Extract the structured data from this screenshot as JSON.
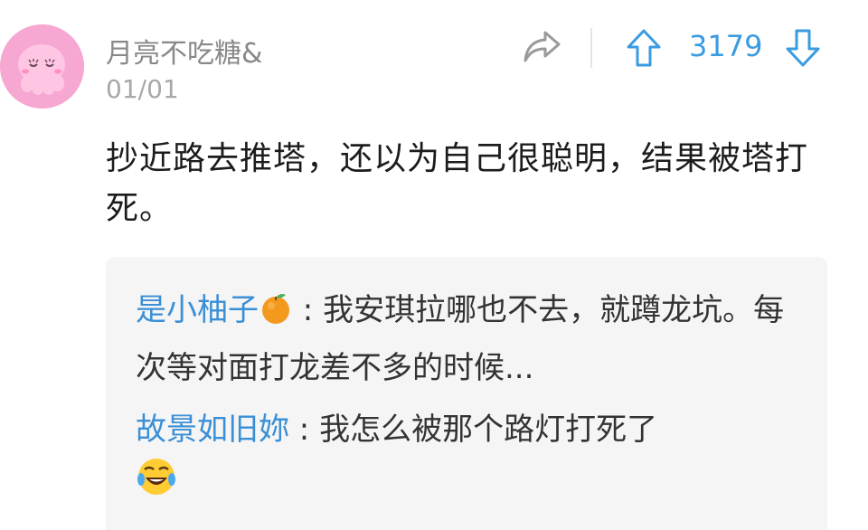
{
  "comment": {
    "author": "月亮不吃糖&",
    "date": "01/01",
    "text": "抄近路去推塔，还以为自己很聪明，结果被塔打死。",
    "vote_count": "3179",
    "icons": {
      "avatar": "pink-octopus-avatar",
      "share": "share-arrow-icon",
      "upvote": "up-arrow-icon",
      "downvote": "down-arrow-icon"
    }
  },
  "replies": [
    {
      "name": "是小柚子",
      "separator": " : ",
      "text": "我安琪拉哪也不去，就蹲龙坑。每次等对面打龙差不多的时候...",
      "name_emoji": "orange-emoji"
    },
    {
      "name": "故景如旧妳",
      "separator": " : ",
      "text": "我怎么被那个路灯打死了",
      "text_emoji": "laughing-tears-emoji"
    }
  ],
  "colors": {
    "username": "#888888",
    "date": "#a8a8a8",
    "vote_accent": "#3a9be0",
    "reply_name": "#3a8fd6",
    "reply_panel": "#f5f5f5",
    "avatar_bg": "#f7a8d2"
  }
}
